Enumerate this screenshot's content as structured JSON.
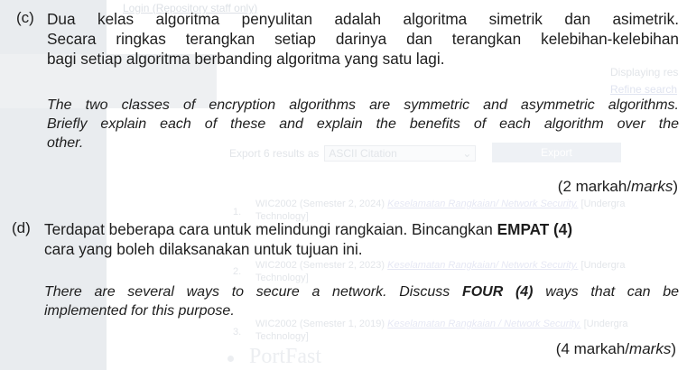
{
  "background": {
    "login_link": "Login (Repository staff only)",
    "displaying": "Displaying res",
    "refine_search": "Refine search",
    "export_label": "Export 6 results as",
    "export_format": "ASCII Citation",
    "export_button": "Export",
    "results": [
      {
        "num": "1.",
        "prefix": "WIC2002 (Semester 2, 2024)",
        "title": "Keselamatan Rangkaian/ Network Security.",
        "suffix": "[Undergra",
        "cont": "Technology]"
      },
      {
        "num": "2.",
        "prefix": "WIC2002 (Semester 2, 2023)",
        "title": "Keselamatan Rangkaian/ Network Security.",
        "suffix": "[Undergra",
        "cont": "Technology]"
      },
      {
        "num": "3.",
        "prefix": "WIC2002 (Semester 1, 2019)",
        "title": "Keselamatan Rangkaian / Network Security.",
        "suffix": "[Undergra",
        "cont": "Technology]"
      }
    ],
    "portfast": "PortFast"
  },
  "question_c": {
    "label": "(c)",
    "malay_lines": [
      "Dua kelas algoritma penyulitan adalah algoritma simetrik dan asimetrik.",
      "Secara ringkas terangkan setiap darinya dan terangkan kelebihan-kelebihan",
      "bagi setiap algoritma berbanding algoritma yang satu lagi."
    ],
    "english_lines": [
      "The two classes of encryption algorithms are symmetric and asymmetric algorithms.",
      "Briefly explain each of these and explain the benefits of each algorithm over the",
      "other."
    ],
    "marks_prefix": "(2 markah/",
    "marks_italic": "marks",
    "marks_suffix": ")"
  },
  "question_d": {
    "label": "(d)",
    "malay_line1_pre": "Terdapat beberapa cara untuk melindungi rangkaian. Bincangkan ",
    "malay_line1_bold": "EMPAT (4)",
    "malay_line2": "cara yang boleh dilaksanakan untuk tujuan ini.",
    "english_line1_pre": "There are several ways to secure a network. Discuss ",
    "english_line1_bold": "FOUR (4)",
    "english_line1_post": " ways that can be",
    "english_line2": "implemented for this purpose.",
    "marks_prefix": "(4 markah/",
    "marks_italic": "marks",
    "marks_suffix": ")"
  }
}
